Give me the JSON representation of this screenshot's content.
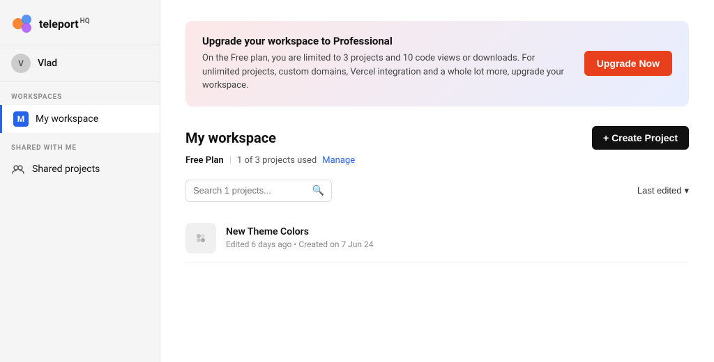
{
  "sidebar": {
    "logo_text": "teleport",
    "logo_hq": "HQ",
    "user": {
      "initial": "V",
      "name": "Vlad"
    },
    "workspaces_label": "WORKSPACES",
    "shared_label": "SHARED WITH ME",
    "workspace_item": {
      "initial": "M",
      "label": "My workspace"
    },
    "shared_item": {
      "label": "Shared projects"
    }
  },
  "banner": {
    "title": "Upgrade your workspace to Professional",
    "description": "On the Free plan, you are limited to 3 projects and 10 code views or downloads.\nFor unlimited projects, custom domains, Vercel integration and a whole lot more, upgrade your workspace.",
    "button_label": "Upgrade Now"
  },
  "workspace": {
    "title": "My workspace",
    "create_button": "+ Create Project",
    "plan": "Free Plan",
    "usage": "1 of 3 projects used",
    "manage_label": "Manage"
  },
  "search": {
    "placeholder": "Search 1 projects..."
  },
  "sort": {
    "label": "Last edited",
    "chevron": "▾"
  },
  "projects": [
    {
      "name": "New Theme Colors",
      "meta": "Edited 6 days ago  •  Created on 7 Jun 24"
    }
  ],
  "colors": {
    "upgrade_btn": "#e8401c",
    "create_btn": "#111111",
    "active_sidebar": "#2563eb"
  }
}
